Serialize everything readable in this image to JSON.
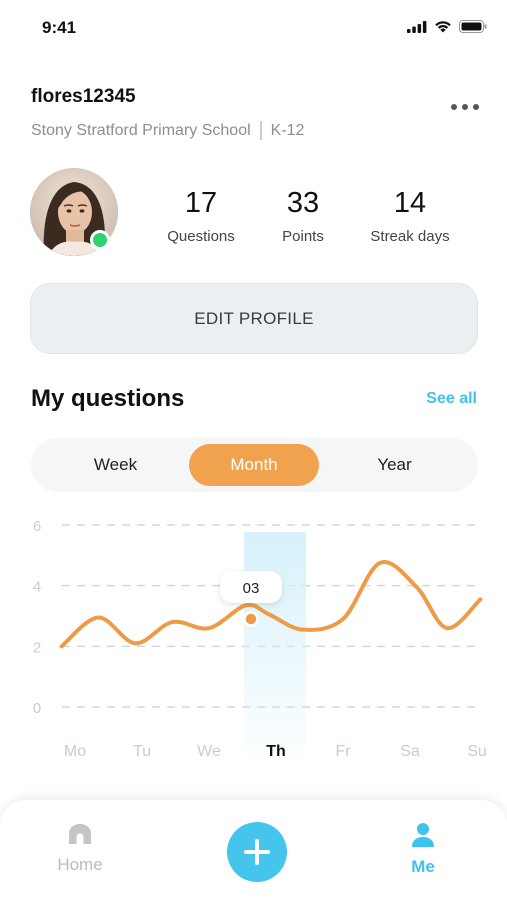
{
  "status_bar": {
    "time": "9:41"
  },
  "profile": {
    "username": "flores12345",
    "school": "Stony Stratford Primary School",
    "grade": "K-12",
    "online": true
  },
  "stats": [
    {
      "value": "17",
      "label": "Questions"
    },
    {
      "value": "33",
      "label": "Points"
    },
    {
      "value": "14",
      "label": "Streak days"
    }
  ],
  "edit_profile_label": "EDIT PROFILE",
  "questions_section": {
    "title": "My questions",
    "see_all": "See all",
    "tabs": [
      {
        "label": "Week",
        "active": false
      },
      {
        "label": "Month",
        "active": true
      },
      {
        "label": "Year",
        "active": false
      }
    ]
  },
  "chart_data": {
    "type": "line",
    "x": [
      "Mo",
      "Tu",
      "We",
      "Th",
      "Fr",
      "Sa",
      "Su"
    ],
    "y_ticks": [
      6,
      4,
      2,
      0
    ],
    "ylim": [
      0,
      6
    ],
    "grid": true,
    "selected": {
      "x": "Th",
      "label": "03"
    },
    "series": [
      {
        "color": "#ee9b45",
        "points": [
          [
            -0.2,
            2.0
          ],
          [
            0.35,
            2.95
          ],
          [
            0.9,
            2.1
          ],
          [
            1.45,
            2.8
          ],
          [
            2.0,
            2.6
          ],
          [
            2.55,
            3.35
          ],
          [
            2.9,
            3.05
          ],
          [
            3.4,
            2.55
          ],
          [
            4.0,
            2.9
          ],
          [
            4.55,
            4.75
          ],
          [
            5.1,
            3.95
          ],
          [
            5.55,
            2.6
          ],
          [
            6.05,
            3.55
          ]
        ]
      }
    ],
    "colors": {
      "highlight_band": "#cfeefb",
      "axis_text": "#c8ccd0",
      "active_label": "#111111"
    }
  },
  "tab_bar": {
    "home_label": "Home",
    "me_label": "Me",
    "active": "Me"
  }
}
